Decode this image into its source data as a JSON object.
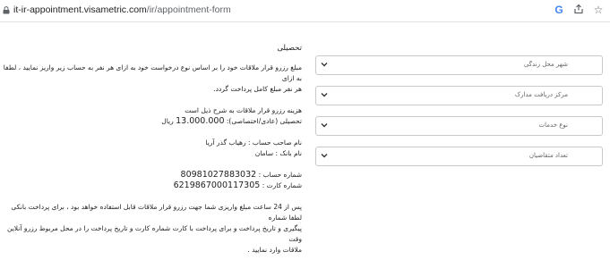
{
  "browser": {
    "url_domain": "it-ir-appointment.visametric.com",
    "url_path": "/ir/appointment-form"
  },
  "icons": {
    "lock": "lock-icon",
    "google": "google-icon",
    "share": "share-icon",
    "star": "star-icon",
    "chevron": "chevron-down-icon"
  },
  "info": {
    "title": "تحصیلی",
    "para1_line1": "مبلغ رزرو قرار ملاقات خود را بر اساس نوع درخواست خود به ازای هر نفر به حساب زیر واریز نمایید ، لطفا به ازای",
    "para1_line2": "هر نفر مبلغ کامل پرداخت گردد.",
    "fee_heading": "هزینه رزرو قرار ملاقات به شرح ذیل است",
    "fee_label": "تحصیلی (عادی/اختصاصی):",
    "fee_amount": "13.000.000",
    "fee_unit": "ریال",
    "holder": "نام صاحب حساب : رهیاب گذر آریا",
    "bank": "نام بانک : سامان",
    "account_label": "شماره حساب :",
    "account_number": "80981027883032",
    "card_label": ": شماره کارت",
    "card_number": "6219867000117305",
    "note_line1": "پس از 24 ساعت مبلغ واریزی شما جهت رزرو قرار ملاقات قابل استفاده خواهد بود ، برای پرداخت بانکی لطفا شماره",
    "note_line2": "پیگیری و تاریخ پرداخت و برای پرداخت با کارت شماره کارت و تاریخ پرداخت را در محل مربوط رزرو آنلاین وقت",
    "note_line3": "ملاقات وارد نمایید ."
  },
  "selects": [
    {
      "label": "شهر محل زندگی"
    },
    {
      "label": "مرکز دریافت مدارک"
    },
    {
      "label": "نوع خدمات"
    },
    {
      "label": "تعداد متقاضیان"
    }
  ]
}
